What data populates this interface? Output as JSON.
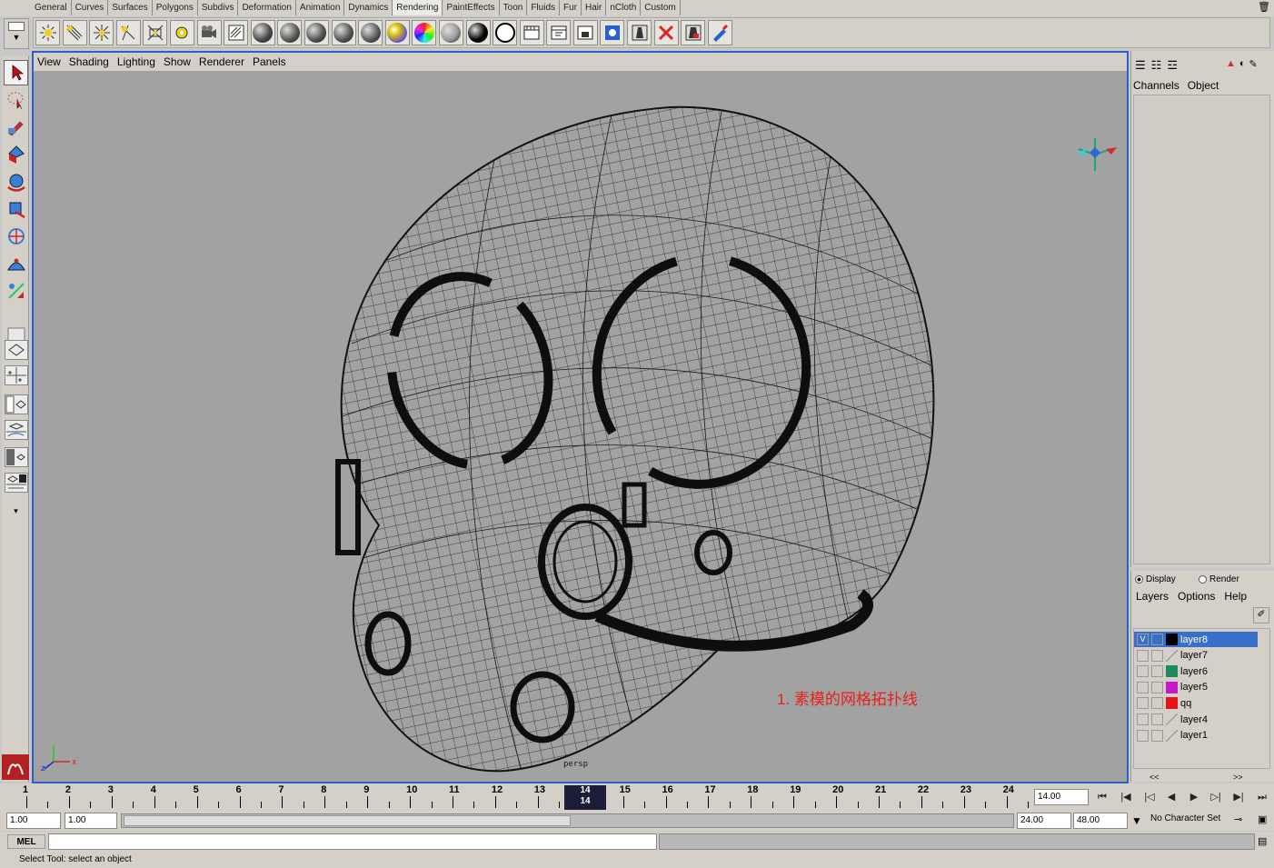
{
  "shelf_tabs": [
    "General",
    "Curves",
    "Surfaces",
    "Polygons",
    "Subdivs",
    "Deformation",
    "Animation",
    "Dynamics",
    "Rendering",
    "PaintEffects",
    "Toon",
    "Fluids",
    "Fur",
    "Hair",
    "nCloth",
    "Custom"
  ],
  "active_shelf": "Rendering",
  "viewport_menu": [
    "View",
    "Shading",
    "Lighting",
    "Show",
    "Renderer",
    "Panels"
  ],
  "channel_box": {
    "tabs": [
      "Channels",
      "Object"
    ]
  },
  "layer_editor": {
    "mode": {
      "display_label": "Display",
      "render_label": "Render",
      "selected": "Display"
    },
    "menu": [
      "Layers",
      "Options",
      "Help"
    ],
    "layers": [
      {
        "name": "layer8",
        "visible": "V",
        "color": "#000000",
        "selected": true
      },
      {
        "name": "layer7",
        "visible": "",
        "color": "none",
        "selected": false
      },
      {
        "name": "layer6",
        "visible": "",
        "color": "#1e8a5e",
        "selected": false
      },
      {
        "name": "layer5",
        "visible": "",
        "color": "#c419c8",
        "selected": false
      },
      {
        "name": "qq",
        "visible": "",
        "color": "#e8141a",
        "selected": false
      },
      {
        "name": "layer4",
        "visible": "",
        "color": "none",
        "selected": false
      },
      {
        "name": "layer1",
        "visible": "",
        "color": "none",
        "selected": false
      }
    ],
    "scroll_left": "<<",
    "scroll_right": ">>"
  },
  "viewport": {
    "camera": "persp",
    "annotation": "1.     素模的网格拓扑线"
  },
  "timeline": {
    "ticks": [
      "1",
      "2",
      "3",
      "4",
      "5",
      "6",
      "7",
      "8",
      "9",
      "10",
      "11",
      "12",
      "13",
      "14",
      "15",
      "16",
      "17",
      "18",
      "19",
      "20",
      "21",
      "22",
      "23",
      "24"
    ],
    "current_frame": "14",
    "current_frame_field": "14.00"
  },
  "range": {
    "start": "1.00",
    "playback_start": "1.00",
    "playback_end": "24.00",
    "end": "48.00",
    "character_set": "No Character Set"
  },
  "command_line": {
    "label": "MEL"
  },
  "help_line": "Select Tool: select an object"
}
